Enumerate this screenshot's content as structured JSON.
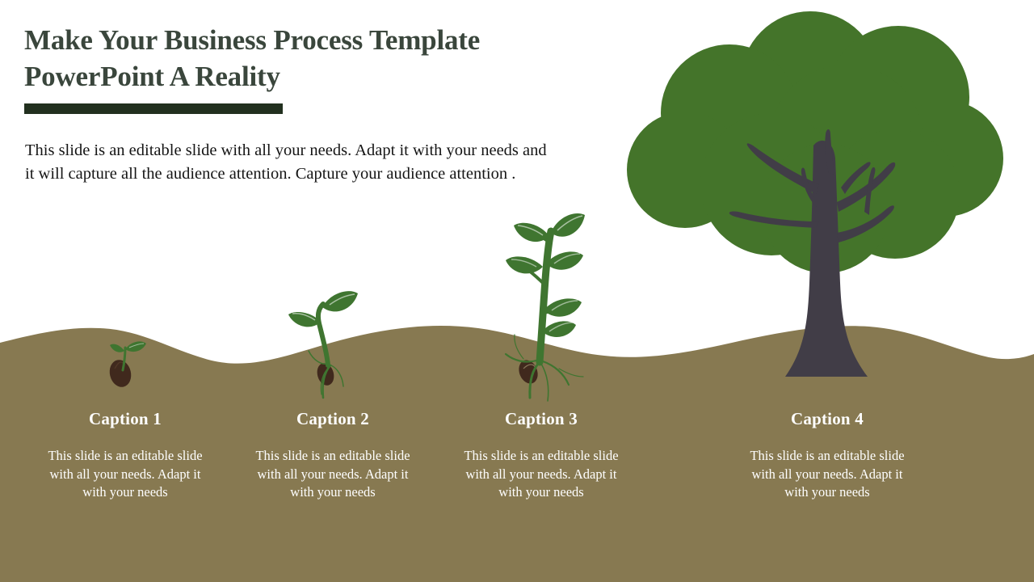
{
  "slide": {
    "background_color": "#ffffff",
    "title": "Make Your Business Process Template PowerPoint A Reality",
    "title_color": "#3a463c",
    "rule_color": "#22301f",
    "intro_paragraph": "This slide is an editable slide with all your needs. Adapt it with your needs and it will capture all the audience attention. Capture your audience attention .",
    "intro_color": "#151515"
  },
  "scene": {
    "soil_color": "#877951",
    "plant_green": "#3f7530",
    "canopy_green": "#44742a",
    "trunk_color": "#413d47",
    "seed_color": "#40291d",
    "stages": [
      {
        "name": "seed-sprout",
        "label": "stage-1-seed"
      },
      {
        "name": "young-seedling",
        "label": "stage-2-seedling"
      },
      {
        "name": "growing-plant",
        "label": "stage-3-plant"
      },
      {
        "name": "mature-tree",
        "label": "stage-4-tree"
      }
    ]
  },
  "captions": [
    {
      "title": "Caption 1",
      "body": "This slide is an editable slide with all your needs. Adapt it with your needs"
    },
    {
      "title": "Caption 2",
      "body": "This slide is an editable slide with all your needs. Adapt it with your needs"
    },
    {
      "title": "Caption 3",
      "body": "This slide is an editable slide with all your needs. Adapt it with your needs"
    },
    {
      "title": "Caption 4",
      "body": "This slide is an editable slide with all your needs. Adapt it with your needs"
    }
  ]
}
